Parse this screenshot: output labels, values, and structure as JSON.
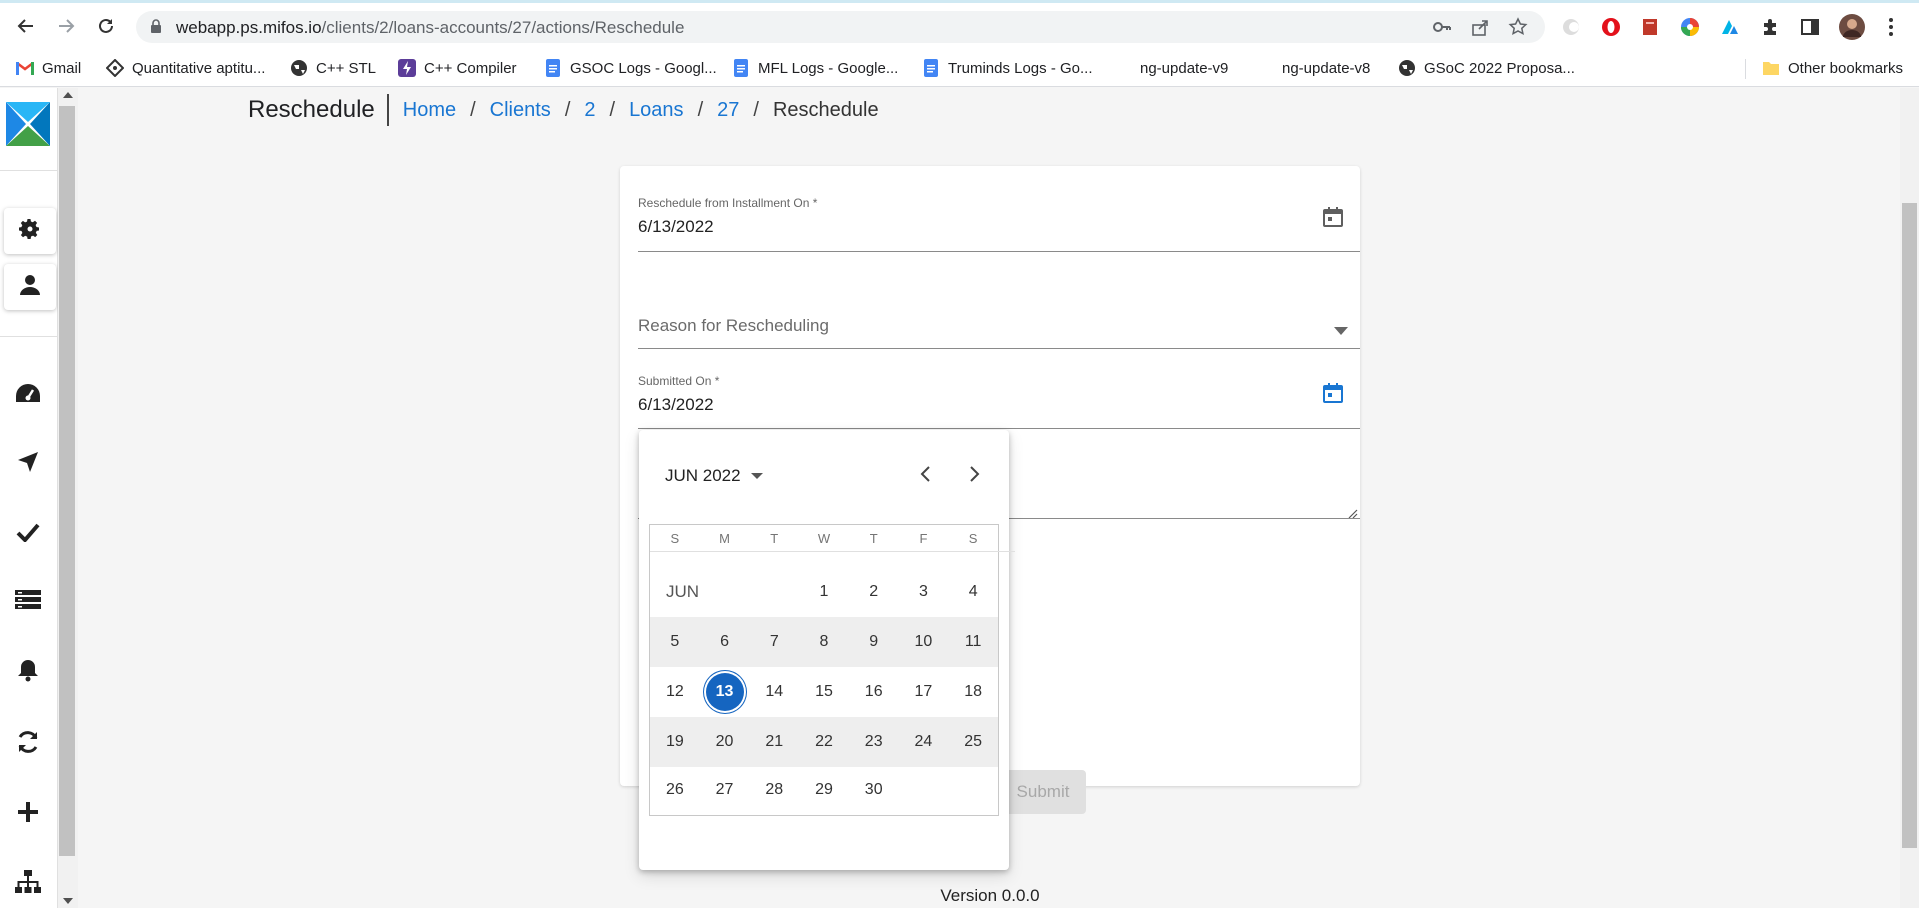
{
  "browser": {
    "url_host": "webapp.ps.mifos.io",
    "url_path": "/clients/2/loans-accounts/27/actions/Reschedule",
    "bookmarks": [
      {
        "label": "Gmail",
        "icon": "gmail-icon"
      },
      {
        "label": "Quantitative aptitu...",
        "icon": "site-icon"
      },
      {
        "label": "C++ STL",
        "icon": "globe-icon"
      },
      {
        "label": "C++ Compiler",
        "icon": "bolt-icon"
      },
      {
        "label": "GSOC Logs - Googl...",
        "icon": "docs-icon"
      },
      {
        "label": "MFL Logs - Google...",
        "icon": "docs-icon"
      },
      {
        "label": "Truminds Logs - Go...",
        "icon": "docs-icon"
      },
      {
        "label": "ng-update-v9",
        "icon": "none"
      },
      {
        "label": "ng-update-v8",
        "icon": "none"
      },
      {
        "label": "GSoC 2022 Proposa...",
        "icon": "globe-icon"
      }
    ],
    "other_bookmarks": "Other bookmarks"
  },
  "page": {
    "title": "Reschedule",
    "breadcrumb": [
      "Home",
      "Clients",
      "2",
      "Loans",
      "27",
      "Reschedule"
    ]
  },
  "form": {
    "reschedule_from_label": "Reschedule from Installment On *",
    "reschedule_from_value": "6/13/2022",
    "reason_placeholder": "Reason for Rescheduling",
    "submitted_on_label": "Submitted On *",
    "submitted_on_value": "6/13/2022",
    "submit_label": "Submit"
  },
  "datepicker": {
    "period_label": "JUN 2022",
    "weekdays": [
      "S",
      "M",
      "T",
      "W",
      "T",
      "F",
      "S"
    ],
    "month_label": "JUN",
    "selected_day": "13",
    "weeks": [
      [
        "",
        "",
        "",
        "1",
        "2",
        "3",
        "4"
      ],
      [
        "5",
        "6",
        "7",
        "8",
        "9",
        "10",
        "11"
      ],
      [
        "12",
        "13",
        "14",
        "15",
        "16",
        "17",
        "18"
      ],
      [
        "19",
        "20",
        "21",
        "22",
        "23",
        "24",
        "25"
      ],
      [
        "26",
        "27",
        "28",
        "29",
        "30",
        "",
        ""
      ]
    ]
  },
  "footer": {
    "version": "Version 0.0.0"
  },
  "colors": {
    "link": "#1976d2",
    "selected_day": "#1565c0"
  }
}
